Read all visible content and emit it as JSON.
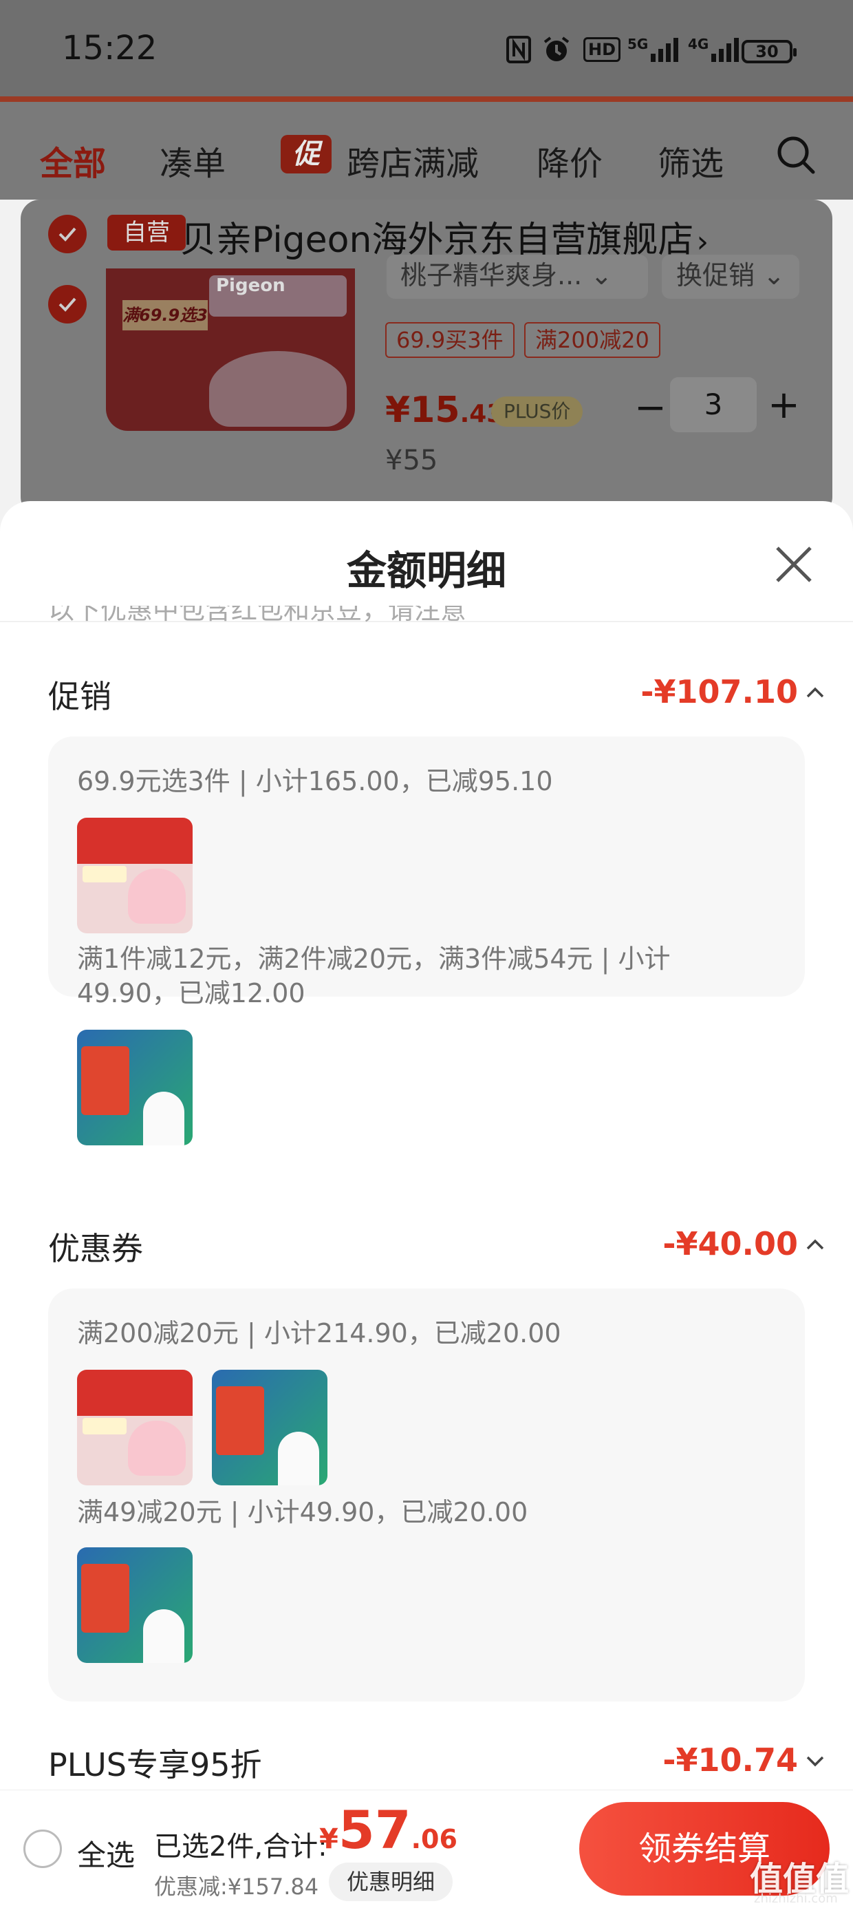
{
  "status_bar": {
    "time": "15:22",
    "battery": "30",
    "network_1": "5G",
    "network_2": "4G",
    "hd_label": "HD"
  },
  "tabs": [
    {
      "label": "全部"
    },
    {
      "label": "凑单"
    },
    {
      "label": "跨店满减",
      "badge": "促"
    },
    {
      "label": "降价"
    },
    {
      "label": "筛选"
    }
  ],
  "store": {
    "self_badge": "自营",
    "name": "贝亲Pigeon海外京东自营旗舰店",
    "product": {
      "variant": "桃子精华爽身...",
      "change_promo": "换促销",
      "tags": [
        "69.9买3件",
        "满200减20"
      ],
      "price_symbol": "¥",
      "price_int": "15",
      "price_dec": ".43",
      "plus_badge": "PLUS价",
      "quantity": "3",
      "original_price": "¥55",
      "thumb_promo": "满69.9选3"
    }
  },
  "sheet": {
    "title": "金额明细",
    "faded_text": "以下优惠中包含红包和京豆，请注意",
    "sections": [
      {
        "label": "促销",
        "amount": "-¥107.10",
        "groups": [
          {
            "line": "69.9元选3件 | 小计165.00，已减95.10"
          },
          {
            "line1": "满1件减12元，满2件减20元，满3件减54元 | 小计",
            "line2": "49.90，已减12.00"
          }
        ]
      },
      {
        "label": "优惠券",
        "amount": "-¥40.00",
        "groups": [
          {
            "line": "满200减20元 | 小计214.90，已减20.00"
          },
          {
            "line": "满49减20元 | 小计49.90，已减20.00"
          }
        ]
      },
      {
        "label": "PLUS专享95折",
        "amount": "-¥10.74"
      }
    ]
  },
  "bottom_bar": {
    "select_all": "全选",
    "summary": "已选2件,合计:",
    "currency": "¥",
    "total_int": "57",
    "total_dec": ".06",
    "discount": "优惠减:¥157.84",
    "detail_button": "优惠明细",
    "checkout": "领券结算"
  },
  "watermark": {
    "main": "值值值",
    "sub": "zhizhizhi.com"
  },
  "colors": {
    "accent": "#e43b27",
    "checkout_start": "#f5513f",
    "checkout_end": "#e62a1d"
  }
}
